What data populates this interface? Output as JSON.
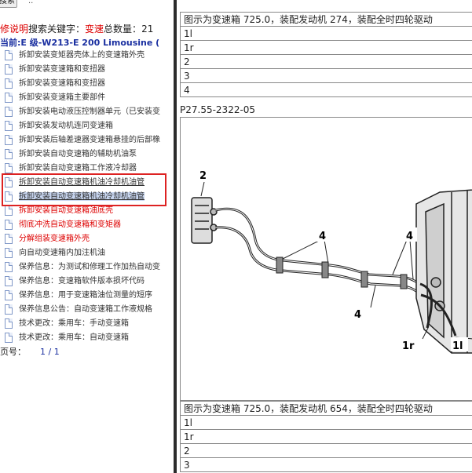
{
  "left_pane": {
    "search_button": "搜索",
    "search_extra": "..",
    "info": {
      "prefix": "修说明",
      "search_label": "搜索关键字：",
      "keyword": "变速",
      "total_label": "总数量：",
      "total": "21"
    },
    "current": "当前:E 级-W213-E 200 Limousine (",
    "items": [
      {
        "label": "拆卸安装变矩器壳体上的变速箱外壳",
        "style": "normal"
      },
      {
        "label": "拆卸安装变速箱和变扭器",
        "style": "normal"
      },
      {
        "label": "拆卸安装变速箱和变扭器",
        "style": "normal"
      },
      {
        "label": "拆卸安装变速箱主要部件",
        "style": "normal"
      },
      {
        "label": "拆卸安装电动液压控制器单元（已安装变",
        "style": "normal"
      },
      {
        "label": "拆卸安装发动机连同变速箱",
        "style": "normal"
      },
      {
        "label": "拆卸安装后轴差速器变速箱悬挂的后部橡",
        "style": "normal"
      },
      {
        "label": "拆卸安装自动变速箱的辅助机油泵",
        "style": "normal"
      },
      {
        "label": "拆卸安装自动变速箱工作液冷却器",
        "style": "normal"
      },
      {
        "label": "拆卸安装自动变速箱机油冷却机油管",
        "style": "underlined"
      },
      {
        "label": "拆卸安装自动变速箱机油冷却机油管",
        "style": "selected"
      },
      {
        "label": "拆卸安装自动变速箱油底壳",
        "style": "red"
      },
      {
        "label": "彻底冲洗自动变速箱和变矩器",
        "style": "red"
      },
      {
        "label": "分解组装变速箱外壳",
        "style": "red"
      },
      {
        "label": "向自动变速箱内加注机油",
        "style": "normal"
      },
      {
        "label": "保养信息：为测试和修理工作加热自动变",
        "style": "normal"
      },
      {
        "label": "保养信息：变速箱软件版本损坏代码",
        "style": "normal"
      },
      {
        "label": "保养信息：用于变速箱油位测量的短序",
        "style": "normal"
      },
      {
        "label": "保养信息公告：自动变速箱工作液规格",
        "style": "normal"
      },
      {
        "label": "技术更改：乘用车：手动变速箱",
        "style": "normal"
      },
      {
        "label": "技术更改：乘用车：自动变速箱",
        "style": "normal"
      }
    ],
    "page": {
      "label": "页号：",
      "value": "1 / 1"
    }
  },
  "right_pane": {
    "table1": {
      "caption": "图示为变速箱 725.0，装配发动机 274，装配全时四轮驱动",
      "rows": [
        "1l",
        "1r",
        "2",
        "3",
        "4"
      ]
    },
    "figure_id": "P27.55-2322-05",
    "figure_callouts": {
      "c1": "2",
      "c2": "4",
      "c3": "4",
      "c4": "4",
      "c5": "1r",
      "c6": "1l"
    },
    "table2": {
      "caption": "图示为变速箱 725.0，装配发动机 654，装配全时四轮驱动",
      "rows": [
        "1l",
        "1r",
        "2",
        "3"
      ]
    }
  },
  "colors": {
    "accent_red": "#dd0000",
    "link_blue": "#1a2fa0",
    "selection": "#c8d6f0",
    "highlight_box": "#dd2222"
  }
}
